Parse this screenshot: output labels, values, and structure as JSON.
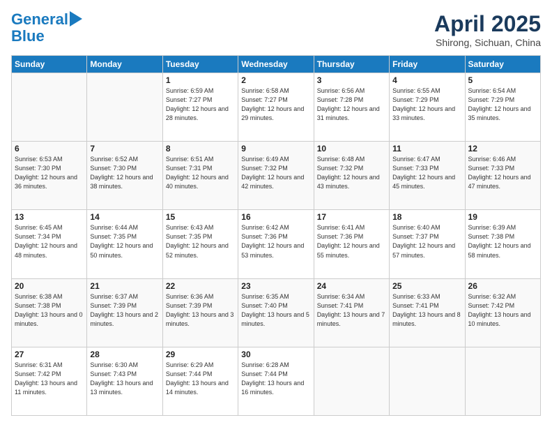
{
  "header": {
    "logo_line1": "General",
    "logo_line2": "Blue",
    "month": "April 2025",
    "location": "Shirong, Sichuan, China"
  },
  "weekdays": [
    "Sunday",
    "Monday",
    "Tuesday",
    "Wednesday",
    "Thursday",
    "Friday",
    "Saturday"
  ],
  "weeks": [
    [
      {
        "day": null
      },
      {
        "day": null
      },
      {
        "day": "1",
        "sunrise": "Sunrise: 6:59 AM",
        "sunset": "Sunset: 7:27 PM",
        "daylight": "Daylight: 12 hours and 28 minutes."
      },
      {
        "day": "2",
        "sunrise": "Sunrise: 6:58 AM",
        "sunset": "Sunset: 7:27 PM",
        "daylight": "Daylight: 12 hours and 29 minutes."
      },
      {
        "day": "3",
        "sunrise": "Sunrise: 6:56 AM",
        "sunset": "Sunset: 7:28 PM",
        "daylight": "Daylight: 12 hours and 31 minutes."
      },
      {
        "day": "4",
        "sunrise": "Sunrise: 6:55 AM",
        "sunset": "Sunset: 7:29 PM",
        "daylight": "Daylight: 12 hours and 33 minutes."
      },
      {
        "day": "5",
        "sunrise": "Sunrise: 6:54 AM",
        "sunset": "Sunset: 7:29 PM",
        "daylight": "Daylight: 12 hours and 35 minutes."
      }
    ],
    [
      {
        "day": "6",
        "sunrise": "Sunrise: 6:53 AM",
        "sunset": "Sunset: 7:30 PM",
        "daylight": "Daylight: 12 hours and 36 minutes."
      },
      {
        "day": "7",
        "sunrise": "Sunrise: 6:52 AM",
        "sunset": "Sunset: 7:30 PM",
        "daylight": "Daylight: 12 hours and 38 minutes."
      },
      {
        "day": "8",
        "sunrise": "Sunrise: 6:51 AM",
        "sunset": "Sunset: 7:31 PM",
        "daylight": "Daylight: 12 hours and 40 minutes."
      },
      {
        "day": "9",
        "sunrise": "Sunrise: 6:49 AM",
        "sunset": "Sunset: 7:32 PM",
        "daylight": "Daylight: 12 hours and 42 minutes."
      },
      {
        "day": "10",
        "sunrise": "Sunrise: 6:48 AM",
        "sunset": "Sunset: 7:32 PM",
        "daylight": "Daylight: 12 hours and 43 minutes."
      },
      {
        "day": "11",
        "sunrise": "Sunrise: 6:47 AM",
        "sunset": "Sunset: 7:33 PM",
        "daylight": "Daylight: 12 hours and 45 minutes."
      },
      {
        "day": "12",
        "sunrise": "Sunrise: 6:46 AM",
        "sunset": "Sunset: 7:33 PM",
        "daylight": "Daylight: 12 hours and 47 minutes."
      }
    ],
    [
      {
        "day": "13",
        "sunrise": "Sunrise: 6:45 AM",
        "sunset": "Sunset: 7:34 PM",
        "daylight": "Daylight: 12 hours and 48 minutes."
      },
      {
        "day": "14",
        "sunrise": "Sunrise: 6:44 AM",
        "sunset": "Sunset: 7:35 PM",
        "daylight": "Daylight: 12 hours and 50 minutes."
      },
      {
        "day": "15",
        "sunrise": "Sunrise: 6:43 AM",
        "sunset": "Sunset: 7:35 PM",
        "daylight": "Daylight: 12 hours and 52 minutes."
      },
      {
        "day": "16",
        "sunrise": "Sunrise: 6:42 AM",
        "sunset": "Sunset: 7:36 PM",
        "daylight": "Daylight: 12 hours and 53 minutes."
      },
      {
        "day": "17",
        "sunrise": "Sunrise: 6:41 AM",
        "sunset": "Sunset: 7:36 PM",
        "daylight": "Daylight: 12 hours and 55 minutes."
      },
      {
        "day": "18",
        "sunrise": "Sunrise: 6:40 AM",
        "sunset": "Sunset: 7:37 PM",
        "daylight": "Daylight: 12 hours and 57 minutes."
      },
      {
        "day": "19",
        "sunrise": "Sunrise: 6:39 AM",
        "sunset": "Sunset: 7:38 PM",
        "daylight": "Daylight: 12 hours and 58 minutes."
      }
    ],
    [
      {
        "day": "20",
        "sunrise": "Sunrise: 6:38 AM",
        "sunset": "Sunset: 7:38 PM",
        "daylight": "Daylight: 13 hours and 0 minutes."
      },
      {
        "day": "21",
        "sunrise": "Sunrise: 6:37 AM",
        "sunset": "Sunset: 7:39 PM",
        "daylight": "Daylight: 13 hours and 2 minutes."
      },
      {
        "day": "22",
        "sunrise": "Sunrise: 6:36 AM",
        "sunset": "Sunset: 7:39 PM",
        "daylight": "Daylight: 13 hours and 3 minutes."
      },
      {
        "day": "23",
        "sunrise": "Sunrise: 6:35 AM",
        "sunset": "Sunset: 7:40 PM",
        "daylight": "Daylight: 13 hours and 5 minutes."
      },
      {
        "day": "24",
        "sunrise": "Sunrise: 6:34 AM",
        "sunset": "Sunset: 7:41 PM",
        "daylight": "Daylight: 13 hours and 7 minutes."
      },
      {
        "day": "25",
        "sunrise": "Sunrise: 6:33 AM",
        "sunset": "Sunset: 7:41 PM",
        "daylight": "Daylight: 13 hours and 8 minutes."
      },
      {
        "day": "26",
        "sunrise": "Sunrise: 6:32 AM",
        "sunset": "Sunset: 7:42 PM",
        "daylight": "Daylight: 13 hours and 10 minutes."
      }
    ],
    [
      {
        "day": "27",
        "sunrise": "Sunrise: 6:31 AM",
        "sunset": "Sunset: 7:42 PM",
        "daylight": "Daylight: 13 hours and 11 minutes."
      },
      {
        "day": "28",
        "sunrise": "Sunrise: 6:30 AM",
        "sunset": "Sunset: 7:43 PM",
        "daylight": "Daylight: 13 hours and 13 minutes."
      },
      {
        "day": "29",
        "sunrise": "Sunrise: 6:29 AM",
        "sunset": "Sunset: 7:44 PM",
        "daylight": "Daylight: 13 hours and 14 minutes."
      },
      {
        "day": "30",
        "sunrise": "Sunrise: 6:28 AM",
        "sunset": "Sunset: 7:44 PM",
        "daylight": "Daylight: 13 hours and 16 minutes."
      },
      {
        "day": null
      },
      {
        "day": null
      },
      {
        "day": null
      }
    ]
  ]
}
